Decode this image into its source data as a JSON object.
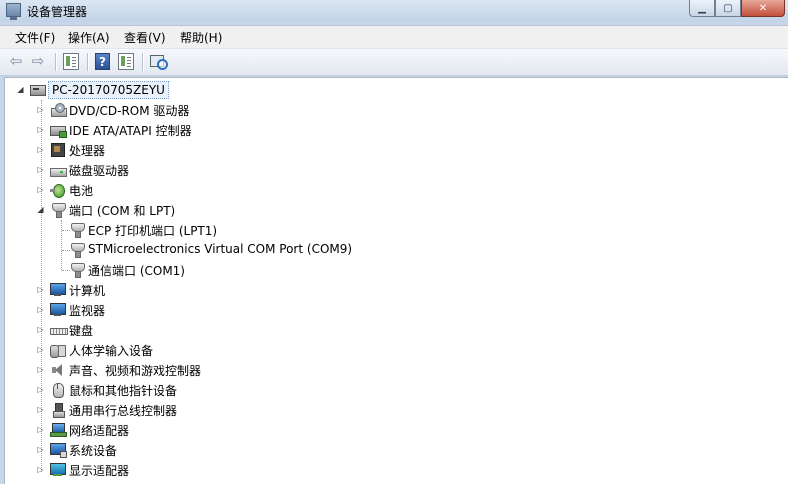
{
  "window": {
    "title": "设备管理器"
  },
  "menu": [
    "文件(F)",
    "操作(A)",
    "查看(V)",
    "帮助(H)"
  ],
  "toolbar": {
    "help_glyph": "?"
  },
  "tree": {
    "root": "PC-20170705ZEYU",
    "categories": [
      {
        "label": "DVD/CD-ROM 驱动器",
        "icon": "dvd-drive-icon"
      },
      {
        "label": "IDE ATA/ATAPI 控制器",
        "icon": "ide-controller-icon"
      },
      {
        "label": "处理器",
        "icon": "processor-icon"
      },
      {
        "label": "磁盘驱动器",
        "icon": "disk-drive-icon"
      },
      {
        "label": "电池",
        "icon": "battery-icon"
      },
      {
        "label": "端口 (COM 和 LPT)",
        "icon": "port-icon",
        "expanded": true,
        "children": [
          {
            "label": "ECP 打印机端口 (LPT1)",
            "icon": "port-icon"
          },
          {
            "label": "STMicroelectronics Virtual COM Port (COM9)",
            "icon": "port-icon"
          },
          {
            "label": "通信端口 (COM1)",
            "icon": "port-icon"
          }
        ]
      },
      {
        "label": "计算机",
        "icon": "computer-icon"
      },
      {
        "label": "监视器",
        "icon": "monitor-icon"
      },
      {
        "label": "键盘",
        "icon": "keyboard-icon"
      },
      {
        "label": "人体学输入设备",
        "icon": "hid-icon"
      },
      {
        "label": "声音、视频和游戏控制器",
        "icon": "sound-icon"
      },
      {
        "label": "鼠标和其他指针设备",
        "icon": "mouse-icon"
      },
      {
        "label": "通用串行总线控制器",
        "icon": "usb-icon"
      },
      {
        "label": "网络适配器",
        "icon": "network-adapter-icon"
      },
      {
        "label": "系统设备",
        "icon": "system-device-icon"
      },
      {
        "label": "显示适配器",
        "icon": "display-adapter-icon"
      }
    ]
  }
}
